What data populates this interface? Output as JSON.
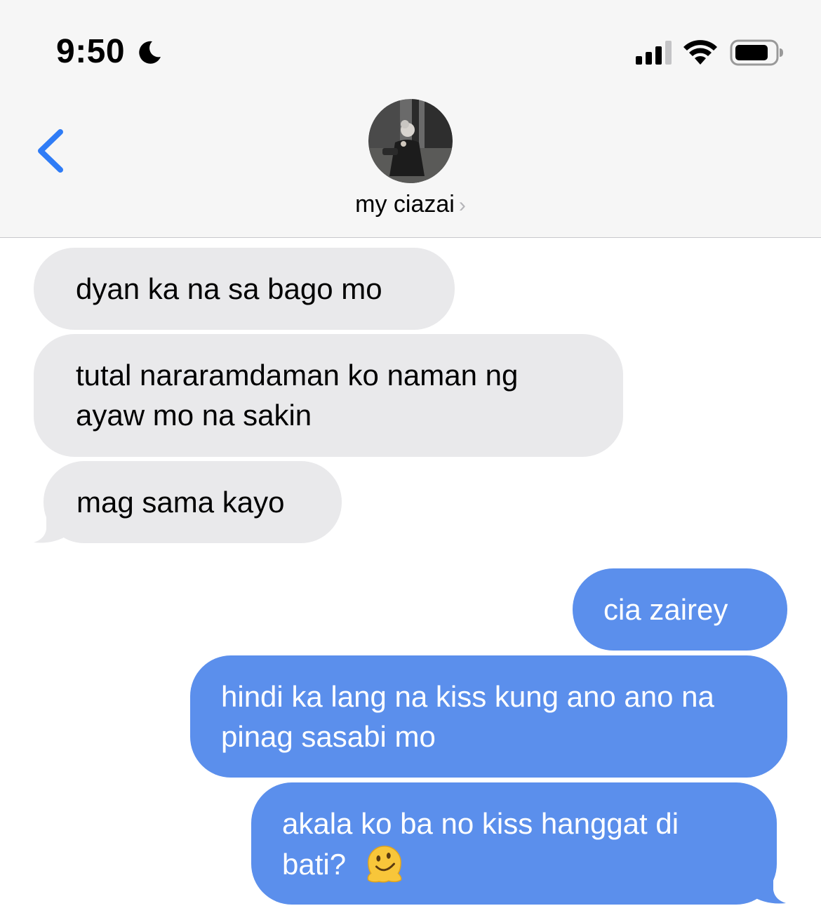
{
  "status_bar": {
    "time": "9:50",
    "icons": [
      "moon-icon",
      "cellular-signal-icon",
      "wifi-icon",
      "battery-icon"
    ]
  },
  "header": {
    "back_icon": "chevron-left-icon",
    "contact_name": "my ciazai",
    "contact_chevron": "›"
  },
  "colors": {
    "incoming_bubble": "#e9e9eb",
    "outgoing_bubble": "#5b8fec",
    "accent": "#2f7cf6"
  },
  "messages": [
    {
      "direction": "incoming",
      "text": "dyan ka na sa bago mo"
    },
    {
      "direction": "incoming",
      "text": "tutal nararamdaman ko naman ng ayaw mo na sakin"
    },
    {
      "direction": "incoming",
      "text": "mag sama kayo"
    },
    {
      "direction": "outgoing",
      "text": "cia zairey"
    },
    {
      "direction": "outgoing",
      "text": "hindi ka lang na kiss kung ano ano na pinag sasabi mo"
    },
    {
      "direction": "outgoing",
      "text": "akala ko ba no kiss hanggat di bati?",
      "emoji": "melting-face-emoji"
    }
  ]
}
